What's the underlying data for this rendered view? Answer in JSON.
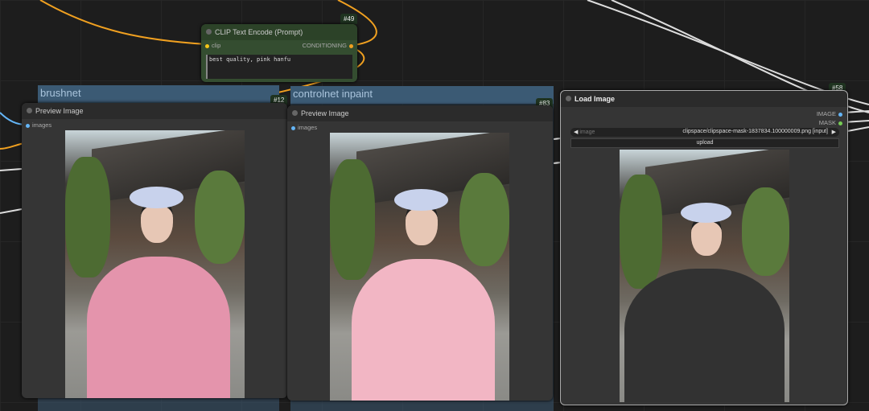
{
  "groups": [
    {
      "title": "brushnet"
    },
    {
      "title": "controlnet inpaint"
    }
  ],
  "clip_node": {
    "id": "#49",
    "title": "CLIP Text Encode (Prompt)",
    "input": "clip",
    "output": "CONDITIONING",
    "text": "best quality, pink hanfu"
  },
  "preview1": {
    "id": "#12",
    "title": "Preview Image",
    "input": "images"
  },
  "preview2": {
    "id": "#83",
    "title": "Preview Image",
    "input": "images"
  },
  "load_image": {
    "id": "#58",
    "title": "Load Image",
    "outputs": [
      "IMAGE",
      "MASK"
    ],
    "widget_label": "image",
    "widget_value": "clipspace/clipspace-mask-1837834.100000009.png [input]",
    "upload": "upload"
  },
  "colors": {
    "wire_conditioning": "#f0a020",
    "wire_clip": "#f5c518",
    "wire_image": "#64b5f6",
    "wire_mask": "#ffffff"
  }
}
